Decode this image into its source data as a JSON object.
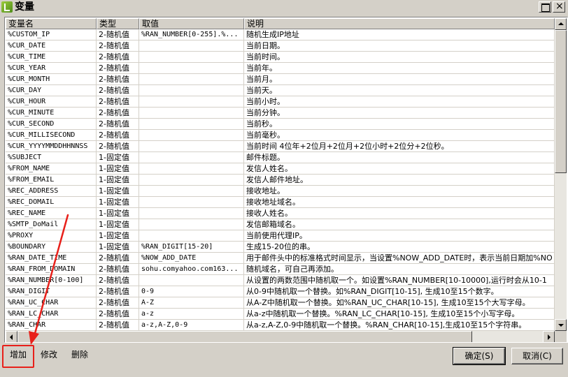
{
  "window": {
    "title": "变量"
  },
  "columns": [
    "变量名",
    "类型",
    "取值",
    "说明"
  ],
  "rows": [
    [
      "%CUSTOM_IP",
      "2-随机值",
      "%RAN_NUMBER[0-255].%...",
      "随机生成IP地址"
    ],
    [
      "%CUR_DATE",
      "2-随机值",
      "",
      "当前日期。"
    ],
    [
      "%CUR_TIME",
      "2-随机值",
      "",
      "当前时间。"
    ],
    [
      "%CUR_YEAR",
      "2-随机值",
      "",
      "当前年。"
    ],
    [
      "%CUR_MONTH",
      "2-随机值",
      "",
      "当前月。"
    ],
    [
      "%CUR_DAY",
      "2-随机值",
      "",
      "当前天。"
    ],
    [
      "%CUR_HOUR",
      "2-随机值",
      "",
      "当前小时。"
    ],
    [
      "%CUR_MINUTE",
      "2-随机值",
      "",
      "当前分钟。"
    ],
    [
      "%CUR_SECOND",
      "2-随机值",
      "",
      "当前秒。"
    ],
    [
      "%CUR_MILLISECOND",
      "2-随机值",
      "",
      "当前毫秒。"
    ],
    [
      "%CUR_YYYYMMDDHHNNSS",
      "2-随机值",
      "",
      "当前时间 4位年+2位月+2位月+2位小时+2位分+2位秒。"
    ],
    [
      "%SUBJECT",
      "1-固定值",
      "",
      "邮件标题。"
    ],
    [
      "%FROM_NAME",
      "1-固定值",
      "",
      "发信人姓名。"
    ],
    [
      "%FROM_EMAIL",
      "1-固定值",
      "",
      "发信人邮件地址。"
    ],
    [
      "%REC_ADDRESS",
      "1-固定值",
      "",
      "接收地址。"
    ],
    [
      "%REC_DOMAIL",
      "1-固定值",
      "",
      "接收地址域名。"
    ],
    [
      "%REC_NAME",
      "1-固定值",
      "",
      "接收人姓名。"
    ],
    [
      "%SMTP_DoMail",
      "1-固定值",
      "",
      "发信邮箱域名。"
    ],
    [
      "%PROXY",
      "1-固定值",
      "",
      "当前使用代理IP。"
    ],
    [
      "%BOUNDARY",
      "1-固定值",
      "%RAN_DIGIT[15-20]",
      "生成15-20位的串。"
    ],
    [
      "%RAN_DATE_TIME",
      "2-随机值",
      "%NOW_ADD_DATE",
      "用于邮件头中的标准格式时间显示，当设置%NOW_ADD_DATE时，表示当前日期加%NO"
    ],
    [
      "%RAN_FROM_DOMAIN",
      "2-随机值",
      "sohu.comyahoo.com163...",
      "随机域名，可自己再添加。"
    ],
    [
      "%RAN_NUMBER[0-100]",
      "2-随机值",
      "",
      "从设置的两数范围中随机取一个。如设置%RAN_NUMBER[10-10000],运行时会从10-1"
    ],
    [
      "%RAN_DIGIT",
      "2-随机值",
      "0-9",
      "从0-9中随机取一个替换。如%RAN_DIGIT[10-15], 生成10至15个数字。"
    ],
    [
      "%RAN_UC_CHAR",
      "2-随机值",
      "A-Z",
      "从A-Z中随机取一个替换。如%RAN_UC_CHAR[10-15], 生成10至15个大写字母。"
    ],
    [
      "%RAN_LC_CHAR",
      "2-随机值",
      "a-z",
      "从a-z中随机取一个替换。%RAN_LC_CHAR[10-15], 生成10至15个小写字母。"
    ],
    [
      "%RAN_CHAR",
      "2-随机值",
      "a-z,A-Z,0-9",
      "从a-z,A-Z,0-9中随机取一个替换。%RAN_CHAR[10-15],生成10至15个字符串。"
    ]
  ],
  "buttons": {
    "add": "增加",
    "edit": "修改",
    "delete": "删除",
    "ok": "确定(S)",
    "cancel": "取消(C)"
  },
  "annotation_color": "#e8201a"
}
